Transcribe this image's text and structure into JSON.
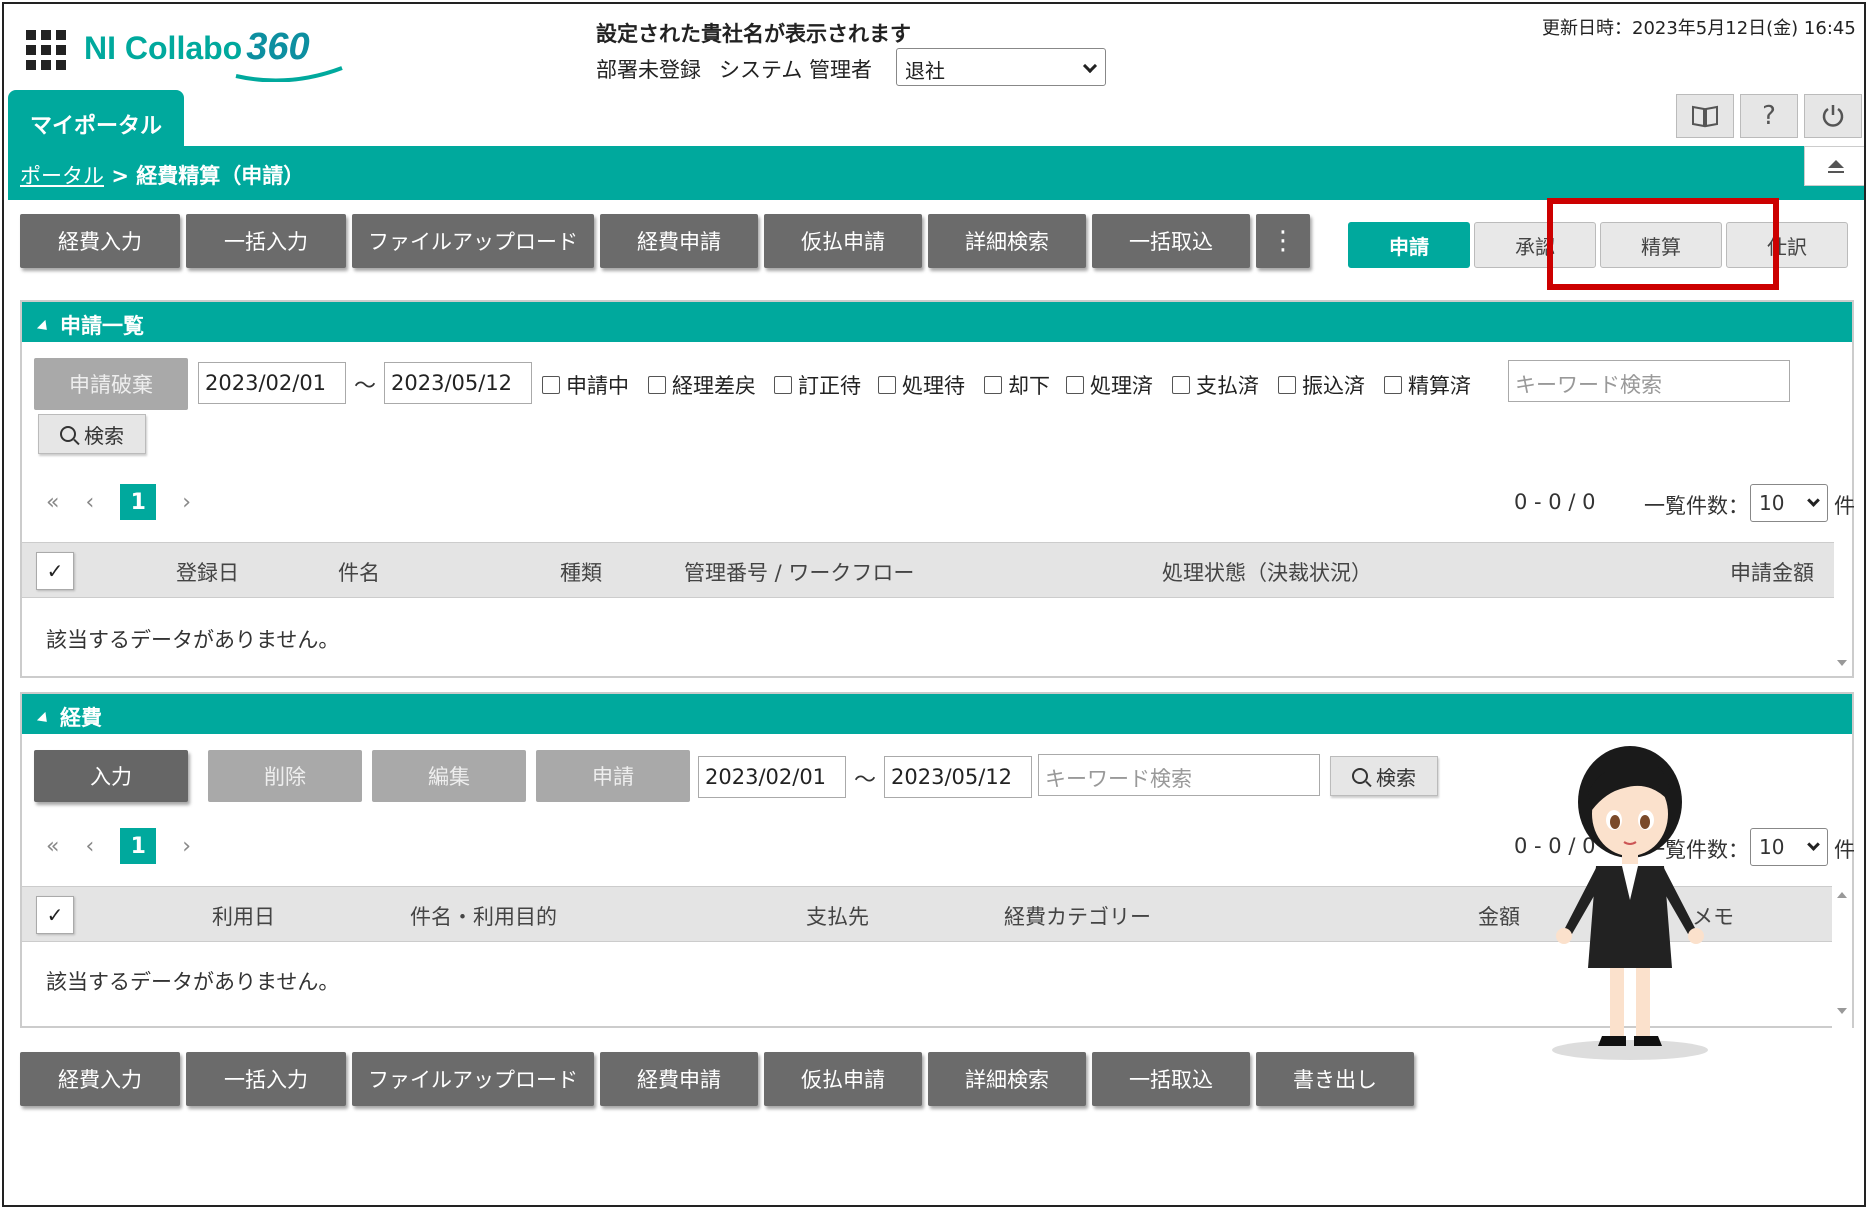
{
  "header": {
    "logo_text": "NI Collabo",
    "logo_number": "360",
    "company": "設定された貴社名が表示されます",
    "department": "部署未登録",
    "user": "システム 管理者",
    "status_value": "退社",
    "updated": "更新日時：2023年5月12日(金) 16:45"
  },
  "tabs": {
    "portal": "マイポータル"
  },
  "breadcrumb": {
    "link": "ポータル",
    "sep": ">",
    "current": "経費精算（申請）"
  },
  "toolbar": {
    "buttons": [
      "経費入力",
      "一括入力",
      "ファイルアップロード",
      "経費申請",
      "仮払申請",
      "詳細検索",
      "一括取込",
      "⋮"
    ],
    "segments": [
      "申請",
      "承認",
      "精算",
      "仕訳"
    ],
    "active_segment": "申請"
  },
  "app_panel": {
    "title": "申請一覧",
    "discard_button": "申請破棄",
    "date_from": "2023/02/01",
    "tilde": "～",
    "date_to": "2023/05/12",
    "checkboxes": [
      "申請中",
      "経理差戻",
      "訂正待",
      "処理待",
      "却下",
      "処理済",
      "支払済",
      "振込済",
      "精算済"
    ],
    "keyword_placeholder": "キーワード検索",
    "search_button": "検索",
    "pager": {
      "first": "«",
      "prev": "‹",
      "page": "1",
      "next": "›"
    },
    "count": "0 - 0 / 0",
    "per_page_label": "一覧件数：",
    "per_page_value": "10",
    "unit": "件",
    "checkall": "✓",
    "columns": [
      "登録日",
      "件名",
      "種類",
      "管理番号 / ワークフロー",
      "処理状態（決裁状況）",
      "申請金額"
    ],
    "empty": "該当するデータがありません。"
  },
  "exp_panel": {
    "title": "経費",
    "buttons": [
      "入力",
      "削除",
      "編集",
      "申請"
    ],
    "date_from": "2023/02/01",
    "tilde": "～",
    "date_to": "2023/05/12",
    "keyword_placeholder": "キーワード検索",
    "search_button": "検索",
    "pager": {
      "first": "«",
      "prev": "‹",
      "page": "1",
      "next": "›"
    },
    "count": "0 - 0 / 0",
    "per_page_label": "一覧件数：",
    "per_page_value": "10",
    "unit": "件",
    "checkall": "✓",
    "columns": [
      "利用日",
      "件名・利用目的",
      "支払先",
      "経費カテゴリー",
      "金額",
      "メモ"
    ],
    "empty": "該当するデータがありません。"
  },
  "bottom_toolbar": {
    "buttons": [
      "経費入力",
      "一括入力",
      "ファイルアップロード",
      "経費申請",
      "仮払申請",
      "詳細検索",
      "一括取込",
      "書き出し"
    ]
  },
  "colors": {
    "accent": "#00a99d",
    "button": "#6b6b6b",
    "highlight": "#cc0000"
  }
}
